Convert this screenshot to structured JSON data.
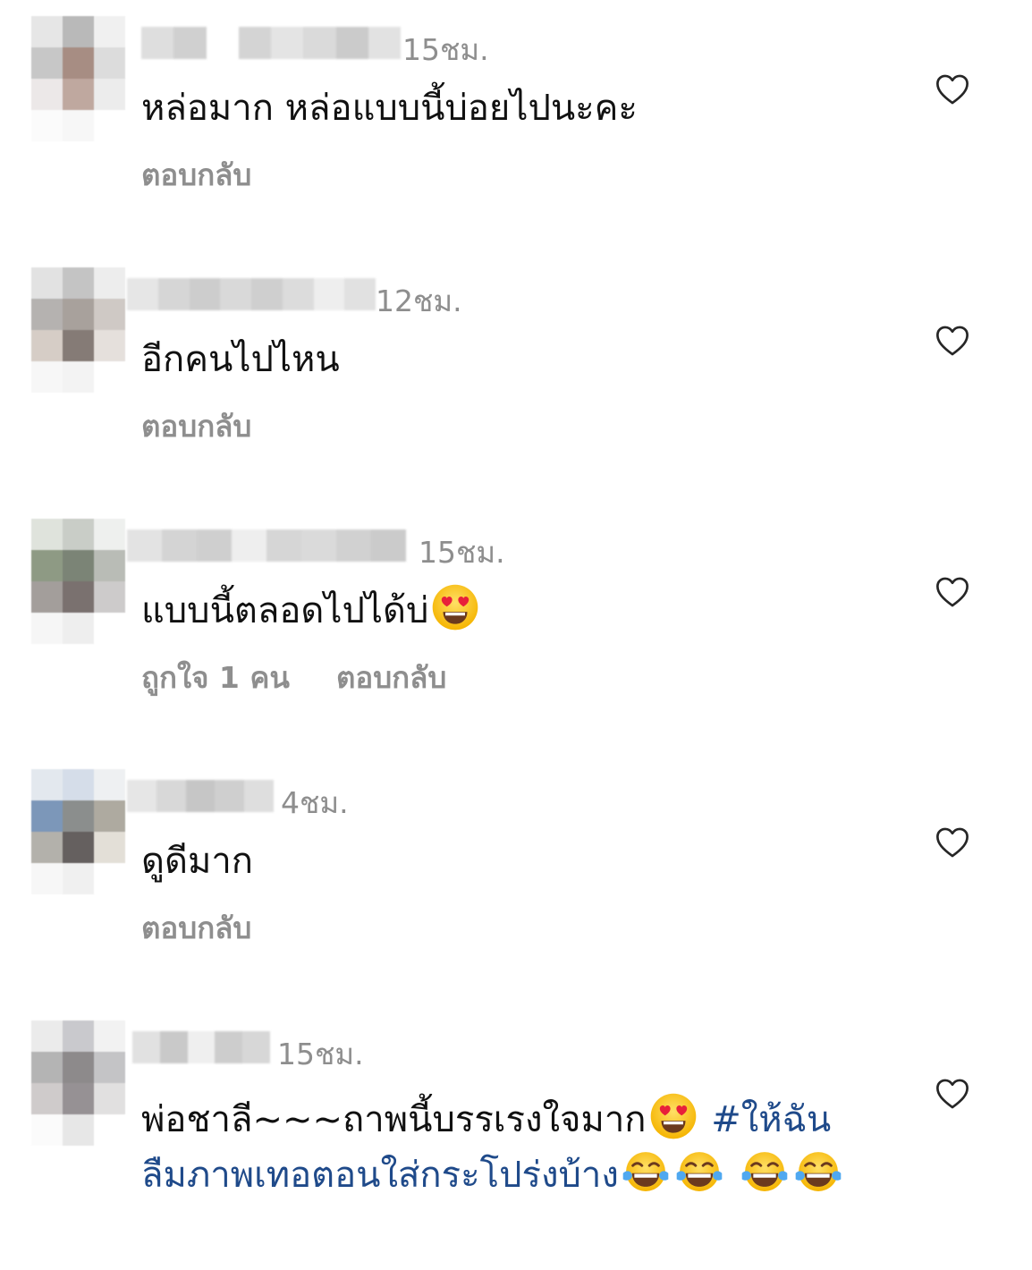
{
  "comments": [
    {
      "time": "15ชม.",
      "text": "หล่อมาก หล่อแบบนี้บ่อยไปนะคะ",
      "reply_label": "ตอบกลับ",
      "likes_label": ""
    },
    {
      "time": "12ชม.",
      "text": "อีกคนไปไหน",
      "reply_label": "ตอบกลับ",
      "likes_label": ""
    },
    {
      "time": "15ชม.",
      "text": "แบบนี้ตลอดไปได้บ่",
      "emoji": "heart-eyes-emoji",
      "reply_label": "ตอบกลับ",
      "likes_label": "ถูกใจ 1 คน"
    },
    {
      "time": "4ชม.",
      "text": "ดูดีมาก",
      "reply_label": "ตอบกลับ",
      "likes_label": ""
    },
    {
      "time": "15ชม.",
      "text_part1": "พ่อชาลี~~~ถาพนี้บรรเรงใจมาก",
      "hashtag": "#ให้ฉันลืมภาพเทอตอนใส่กระโปร่งบ้าง",
      "emojis": [
        "heart-eyes-emoji",
        "tears-of-joy-emoji",
        "tears-of-joy-emoji",
        "tears-of-joy-emoji",
        "tears-of-joy-emoji"
      ]
    }
  ],
  "icons": {
    "like": "heart-outline-icon"
  },
  "colors": {
    "secondary_text": "#8e8e8e",
    "primary_text": "#111111",
    "hashtag": "#1f4a8a"
  }
}
